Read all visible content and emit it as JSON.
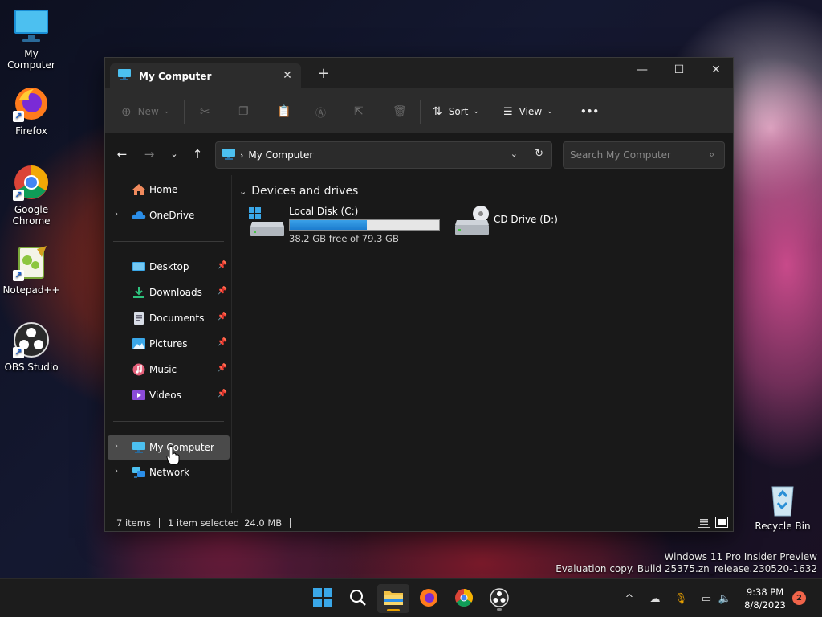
{
  "desktop": {
    "icons": [
      {
        "label": "My Computer"
      },
      {
        "label": "Firefox"
      },
      {
        "label": "Google Chrome"
      },
      {
        "label": "Notepad++"
      },
      {
        "label": "OBS Studio"
      },
      {
        "label": "Recycle Bin"
      }
    ],
    "watermark": {
      "line1": "Windows 11 Pro Insider Preview",
      "line2": "Evaluation copy. Build 25375.zn_release.230520-1632"
    }
  },
  "window": {
    "tab_title": "My Computer",
    "commands": {
      "new_label": "New",
      "sort_label": "Sort",
      "view_label": "View",
      "more_label": "•••"
    },
    "address": {
      "crumb": "My Computer"
    },
    "search": {
      "placeholder": "Search My Computer"
    },
    "sidebar": {
      "home": "Home",
      "onedrive": "OneDrive",
      "quick_access": [
        {
          "label": "Desktop"
        },
        {
          "label": "Downloads"
        },
        {
          "label": "Documents"
        },
        {
          "label": "Pictures"
        },
        {
          "label": "Music"
        },
        {
          "label": "Videos"
        }
      ],
      "my_computer": "My Computer",
      "network": "Network"
    },
    "content": {
      "group_title": "Devices and drives",
      "drives": [
        {
          "name": "Local Disk (C:)",
          "free_text": "38.2 GB free of 79.3 GB",
          "used_fraction": 0.518
        },
        {
          "name": "CD Drive (D:)"
        }
      ]
    },
    "status": {
      "items": "7 items",
      "selected": "1 item selected",
      "size": "24.0 MB"
    }
  },
  "taskbar": {
    "time": "9:38 PM",
    "date": "8/8/2023",
    "notification_count": "2"
  },
  "colors": {
    "accent": "#1c7ccf",
    "explorer_folder": "#f2c144",
    "taskbar_indicator": "#e8a000",
    "notification_badge": "#f0644a"
  }
}
